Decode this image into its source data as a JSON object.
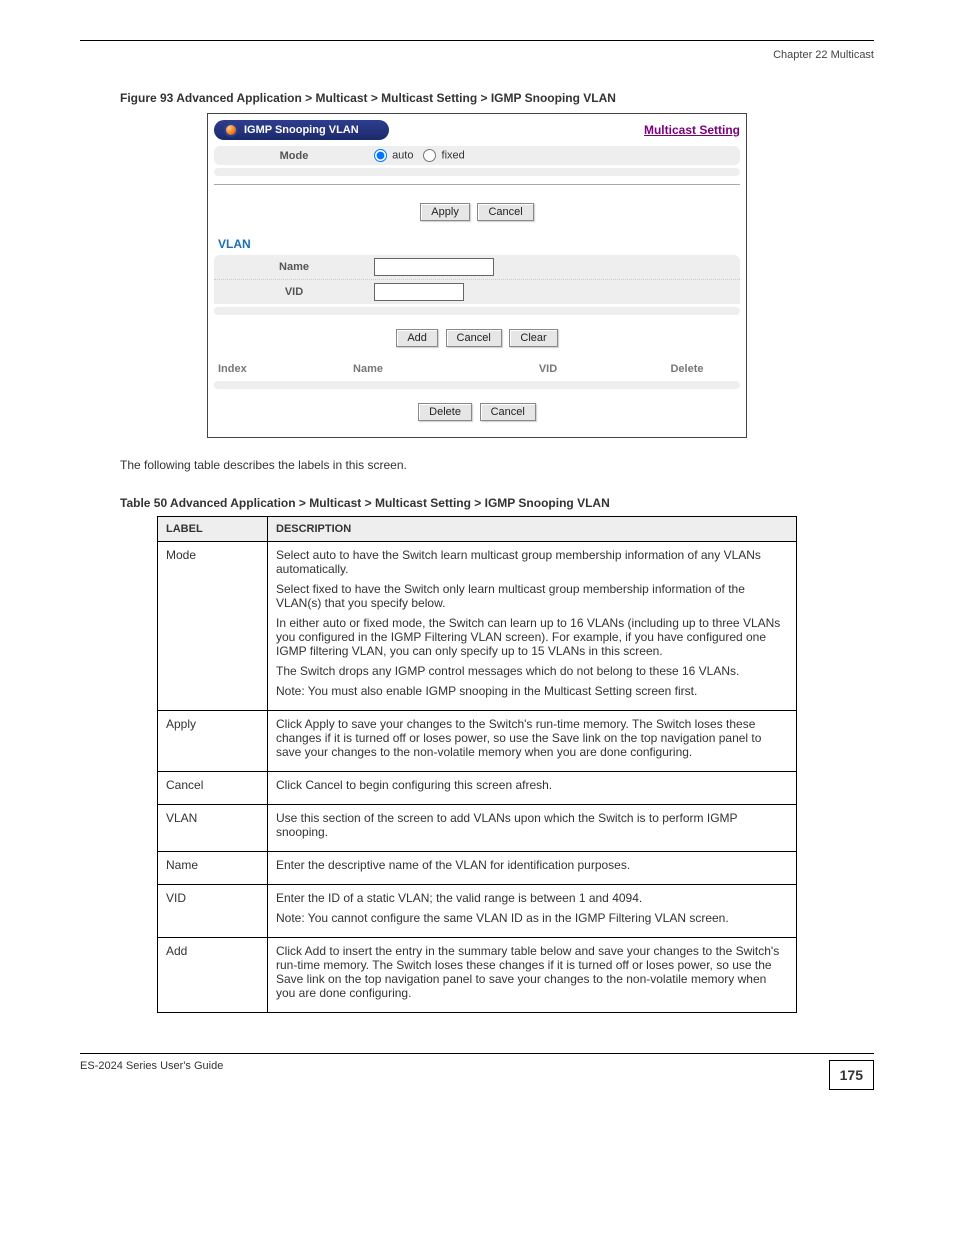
{
  "header": {
    "chapter": "Chapter 22 Multicast"
  },
  "figure": {
    "caption": "Figure 93   Advanced Application > Multicast > Multicast Setting > IGMP Snooping VLAN"
  },
  "ui": {
    "panel_title": "IGMP Snooping VLAN",
    "multicast_link": "Multicast Setting",
    "mode_label": "Mode",
    "mode_options": {
      "auto": "auto",
      "fixed": "fixed"
    },
    "apply": "Apply",
    "cancel": "Cancel",
    "vlan_section": "VLAN",
    "name_label": "Name",
    "vid_label": "VID",
    "add": "Add",
    "clear": "Clear",
    "delete": "Delete",
    "list_headers": {
      "index": "Index",
      "name": "Name",
      "vid": "VID",
      "delete": "Delete"
    }
  },
  "table": {
    "caption": "Table 50   Advanced Application > Multicast > Multicast Setting > IGMP Snooping VLAN",
    "columns": {
      "label": "LABEL",
      "description": "DESCRIPTION"
    },
    "rows": [
      {
        "label": "Mode",
        "desc": [
          "Select auto to have the Switch learn multicast group membership information of any VLANs automatically.",
          "Select fixed to have the Switch only learn multicast group membership information of the VLAN(s) that you specify below.",
          "In either auto or fixed mode, the Switch can learn up to 16 VLANs (including up to three VLANs you configured in the IGMP Filtering VLAN screen). For example, if you have configured one IGMP filtering VLAN, you can only specify up to 15 VLANs in this screen.",
          "The Switch drops any IGMP control messages which do not belong to these 16 VLANs.",
          "Note: You must also enable IGMP snooping in the Multicast Setting screen first."
        ]
      },
      {
        "label": "Apply",
        "desc": [
          "Click Apply to save your changes to the Switch's run-time memory. The Switch loses these changes if it is turned off or loses power, so use the Save link on the top navigation panel to save your changes to the non-volatile memory when you are done configuring."
        ]
      },
      {
        "label": "Cancel",
        "desc": [
          "Click Cancel to begin configuring this screen afresh."
        ]
      },
      {
        "label": "VLAN",
        "desc": [
          "Use this section of the screen to add VLANs upon which the Switch is to perform IGMP snooping."
        ]
      },
      {
        "label": "Name",
        "desc": [
          "Enter the descriptive name of the VLAN for identification purposes."
        ]
      },
      {
        "label": "VID",
        "desc": [
          "Enter the ID of a static VLAN; the valid range is between 1 and 4094.",
          "Note: You cannot configure the same VLAN ID as in the IGMP Filtering VLAN screen."
        ]
      },
      {
        "label": "Add",
        "desc": [
          "Click Add to insert the entry in the summary table below and save your changes to the Switch's run-time memory. The Switch loses these changes if it is turned off or loses power, so use the Save link on the top navigation panel to save your changes to the non-volatile memory when you are done configuring."
        ]
      }
    ]
  },
  "footer": {
    "book": "ES-2024 Series User's Guide",
    "page": "175"
  }
}
